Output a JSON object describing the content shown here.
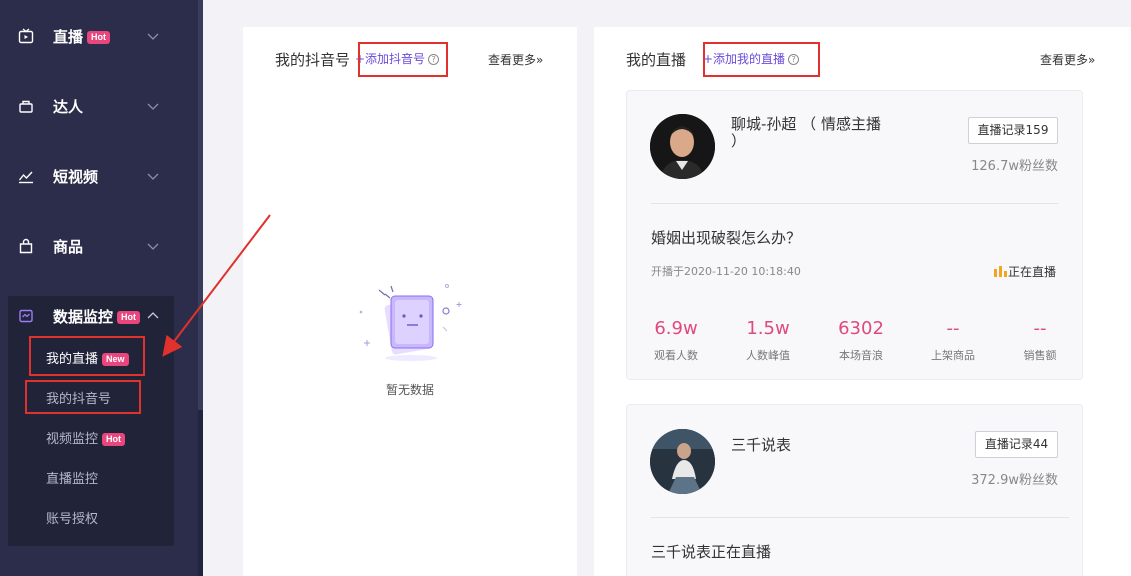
{
  "sidebar": {
    "items": [
      {
        "label": "直播",
        "badge": "Hot",
        "icon": "tv-icon"
      },
      {
        "label": "达人",
        "badge": "",
        "icon": "user-icon"
      },
      {
        "label": "短视频",
        "badge": "",
        "icon": "trend-icon"
      },
      {
        "label": "商品",
        "badge": "",
        "icon": "bag-icon"
      },
      {
        "label": "数据监控",
        "badge": "Hot",
        "icon": "monitor-icon"
      }
    ],
    "submenu": [
      {
        "label": "我的直播",
        "badge": "New"
      },
      {
        "label": "我的抖音号",
        "badge": ""
      },
      {
        "label": "视频监控",
        "badge": "Hot"
      },
      {
        "label": "直播监控",
        "badge": ""
      },
      {
        "label": "账号授权",
        "badge": ""
      }
    ]
  },
  "douyin_card": {
    "title": "我的抖音号",
    "add_label": "+添加抖音号",
    "more_label": "查看更多»",
    "empty_text": "暂无数据"
  },
  "live_card": {
    "title": "我的直播",
    "add_label": "+添加我的直播",
    "more_label": "查看更多»",
    "streams": [
      {
        "name": "聊城-孙超 （ 情感主播 ）",
        "record_label": "直播记录159",
        "fans": "126.7w粉丝数",
        "live_title": "婚姻出现破裂怎么办？",
        "start_time": "开播于2020-11-20 10:18:40",
        "status": "正在直播",
        "stats": [
          {
            "value": "6.9w",
            "label": "观看人数"
          },
          {
            "value": "1.5w",
            "label": "人数峰值"
          },
          {
            "value": "6302",
            "label": "本场音浪"
          },
          {
            "value": "--",
            "label": "上架商品"
          },
          {
            "value": "--",
            "label": "销售额"
          }
        ]
      },
      {
        "name": "三千说表",
        "record_label": "直播记录44",
        "fans": "372.9w粉丝数",
        "live_title": "三千说表正在直播"
      }
    ]
  },
  "colors": {
    "sidebar_bg": "#2b2d4a",
    "accent": "#6a4bd8",
    "badge": "#e8467d",
    "highlight": "#e0312c",
    "stat": "#e0497b"
  }
}
